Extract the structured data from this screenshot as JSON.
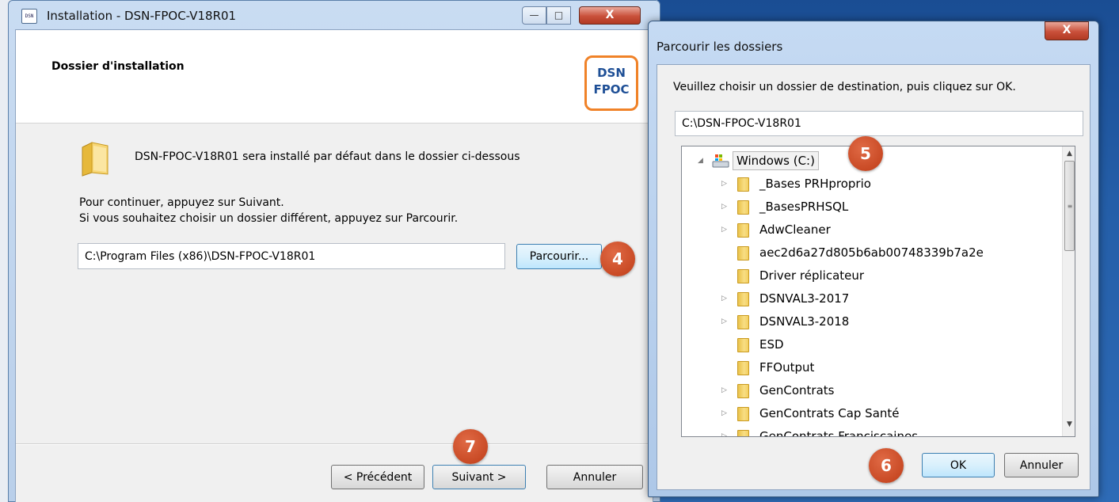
{
  "installer": {
    "title": "Installation - DSN-FPOC-V18R01",
    "app_icon": "app-icon",
    "minimize": "—",
    "maximize": "□",
    "close": "X",
    "heading": "Dossier d'installation",
    "logo_line1": "DSN",
    "logo_line2": "FPOC",
    "logo_color": "#f08228",
    "default_text": "DSN-FPOC-V18R01 sera installé par défaut dans le dossier ci-dessous",
    "continue_line1": "Pour continuer, appuyez sur Suivant.",
    "continue_line2": "Si vous souhaitez choisir un dossier différent, appuyez sur Parcourir.",
    "install_path": "C:\\Program Files (x86)\\DSN-FPOC-V18R01",
    "browse_label": "Parcourir...",
    "prev_label": "< Précédent",
    "next_label": "Suivant >",
    "cancel_label": "Annuler"
  },
  "browse_dialog": {
    "title": "Parcourir les dossiers",
    "close": "X",
    "instruction": "Veuillez choisir un dossier de destination, puis cliquez sur OK.",
    "selected_path": "C:\\DSN-FPOC-V18R01",
    "tree": {
      "root": "Windows (C:)",
      "items": [
        {
          "label": "_Bases PRHproprio",
          "expandable": true
        },
        {
          "label": "_BasesPRHSQL",
          "expandable": true
        },
        {
          "label": "AdwCleaner",
          "expandable": true
        },
        {
          "label": "aec2d6a27d805b6ab00748339b7a2e",
          "expandable": false
        },
        {
          "label": "Driver réplicateur",
          "expandable": false
        },
        {
          "label": "DSNVAL3-2017",
          "expandable": true
        },
        {
          "label": "DSNVAL3-2018",
          "expandable": true
        },
        {
          "label": "ESD",
          "expandable": false
        },
        {
          "label": "FFOutput",
          "expandable": false
        },
        {
          "label": "GenContrats",
          "expandable": true
        },
        {
          "label": "GenContrats Cap Santé",
          "expandable": true
        },
        {
          "label": "GenContrats Franciscaines",
          "expandable": true
        }
      ]
    },
    "ok_label": "OK",
    "cancel_label": "Annuler"
  },
  "badges": {
    "b4": "4",
    "b5": "5",
    "b6": "6",
    "b7": "7",
    "color": "#c94a25"
  }
}
